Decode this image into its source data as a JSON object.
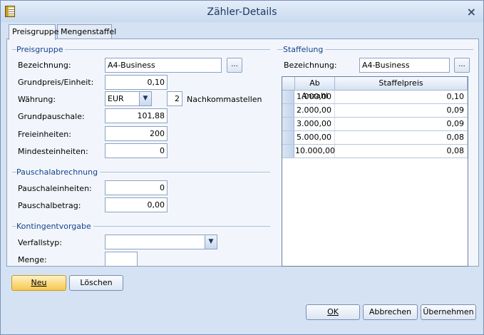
{
  "window": {
    "title": "Zähler-Details"
  },
  "tabs": [
    {
      "label": "Preisgruppe"
    },
    {
      "label": "Mengenstaffel"
    }
  ],
  "preisgruppe": {
    "group_title": "Preisgruppe",
    "bezeichnung_label": "Bezeichnung:",
    "bezeichnung_value": "A4-Business",
    "browse_label": "...",
    "grundpreis_label": "Grundpreis/Einheit:",
    "grundpreis_value": "0,10",
    "waehrung_label": "Währung:",
    "waehrung_value": "EUR",
    "nachkommastellen_value": "2",
    "nachkommastellen_label": "Nachkommastellen",
    "grundpauschale_label": "Grundpauschale:",
    "grundpauschale_value": "101,88",
    "freieinheiten_label": "Freieinheiten:",
    "freieinheiten_value": "200",
    "mindesteinheiten_label": "Mindesteinheiten:",
    "mindesteinheiten_value": "0"
  },
  "pauschal": {
    "group_title": "Pauschalabrechnung",
    "einheiten_label": "Pauschaleinheiten:",
    "einheiten_value": "0",
    "betrag_label": "Pauschalbetrag:",
    "betrag_value": "0,00"
  },
  "kontingent": {
    "group_title": "Kontingentvorgabe",
    "verfallstyp_label": "Verfallstyp:",
    "verfallstyp_value": "",
    "menge_label": "Menge:",
    "menge_value": ""
  },
  "staffelung": {
    "group_title": "Staffelung",
    "bezeichnung_label": "Bezeichnung:",
    "bezeichnung_value": "A4-Business",
    "browse_label": "...",
    "columns": [
      "Ab Anzahl",
      "Staffelpreis"
    ],
    "rows": [
      [
        "1.000,00",
        "0,10"
      ],
      [
        "2.000,00",
        "0,09"
      ],
      [
        "3.000,00",
        "0,09"
      ],
      [
        "5.000,00",
        "0,08"
      ],
      [
        "10.000,00",
        "0,08"
      ]
    ]
  },
  "buttons": {
    "neu": "Neu",
    "loeschen": "Löschen",
    "ok": "OK",
    "abbrechen": "Abbrechen",
    "uebernehmen": "Übernehmen"
  },
  "icons": {
    "app": "counter-app-icon",
    "close": "close-icon",
    "dropdown": "chevron-down-icon"
  }
}
